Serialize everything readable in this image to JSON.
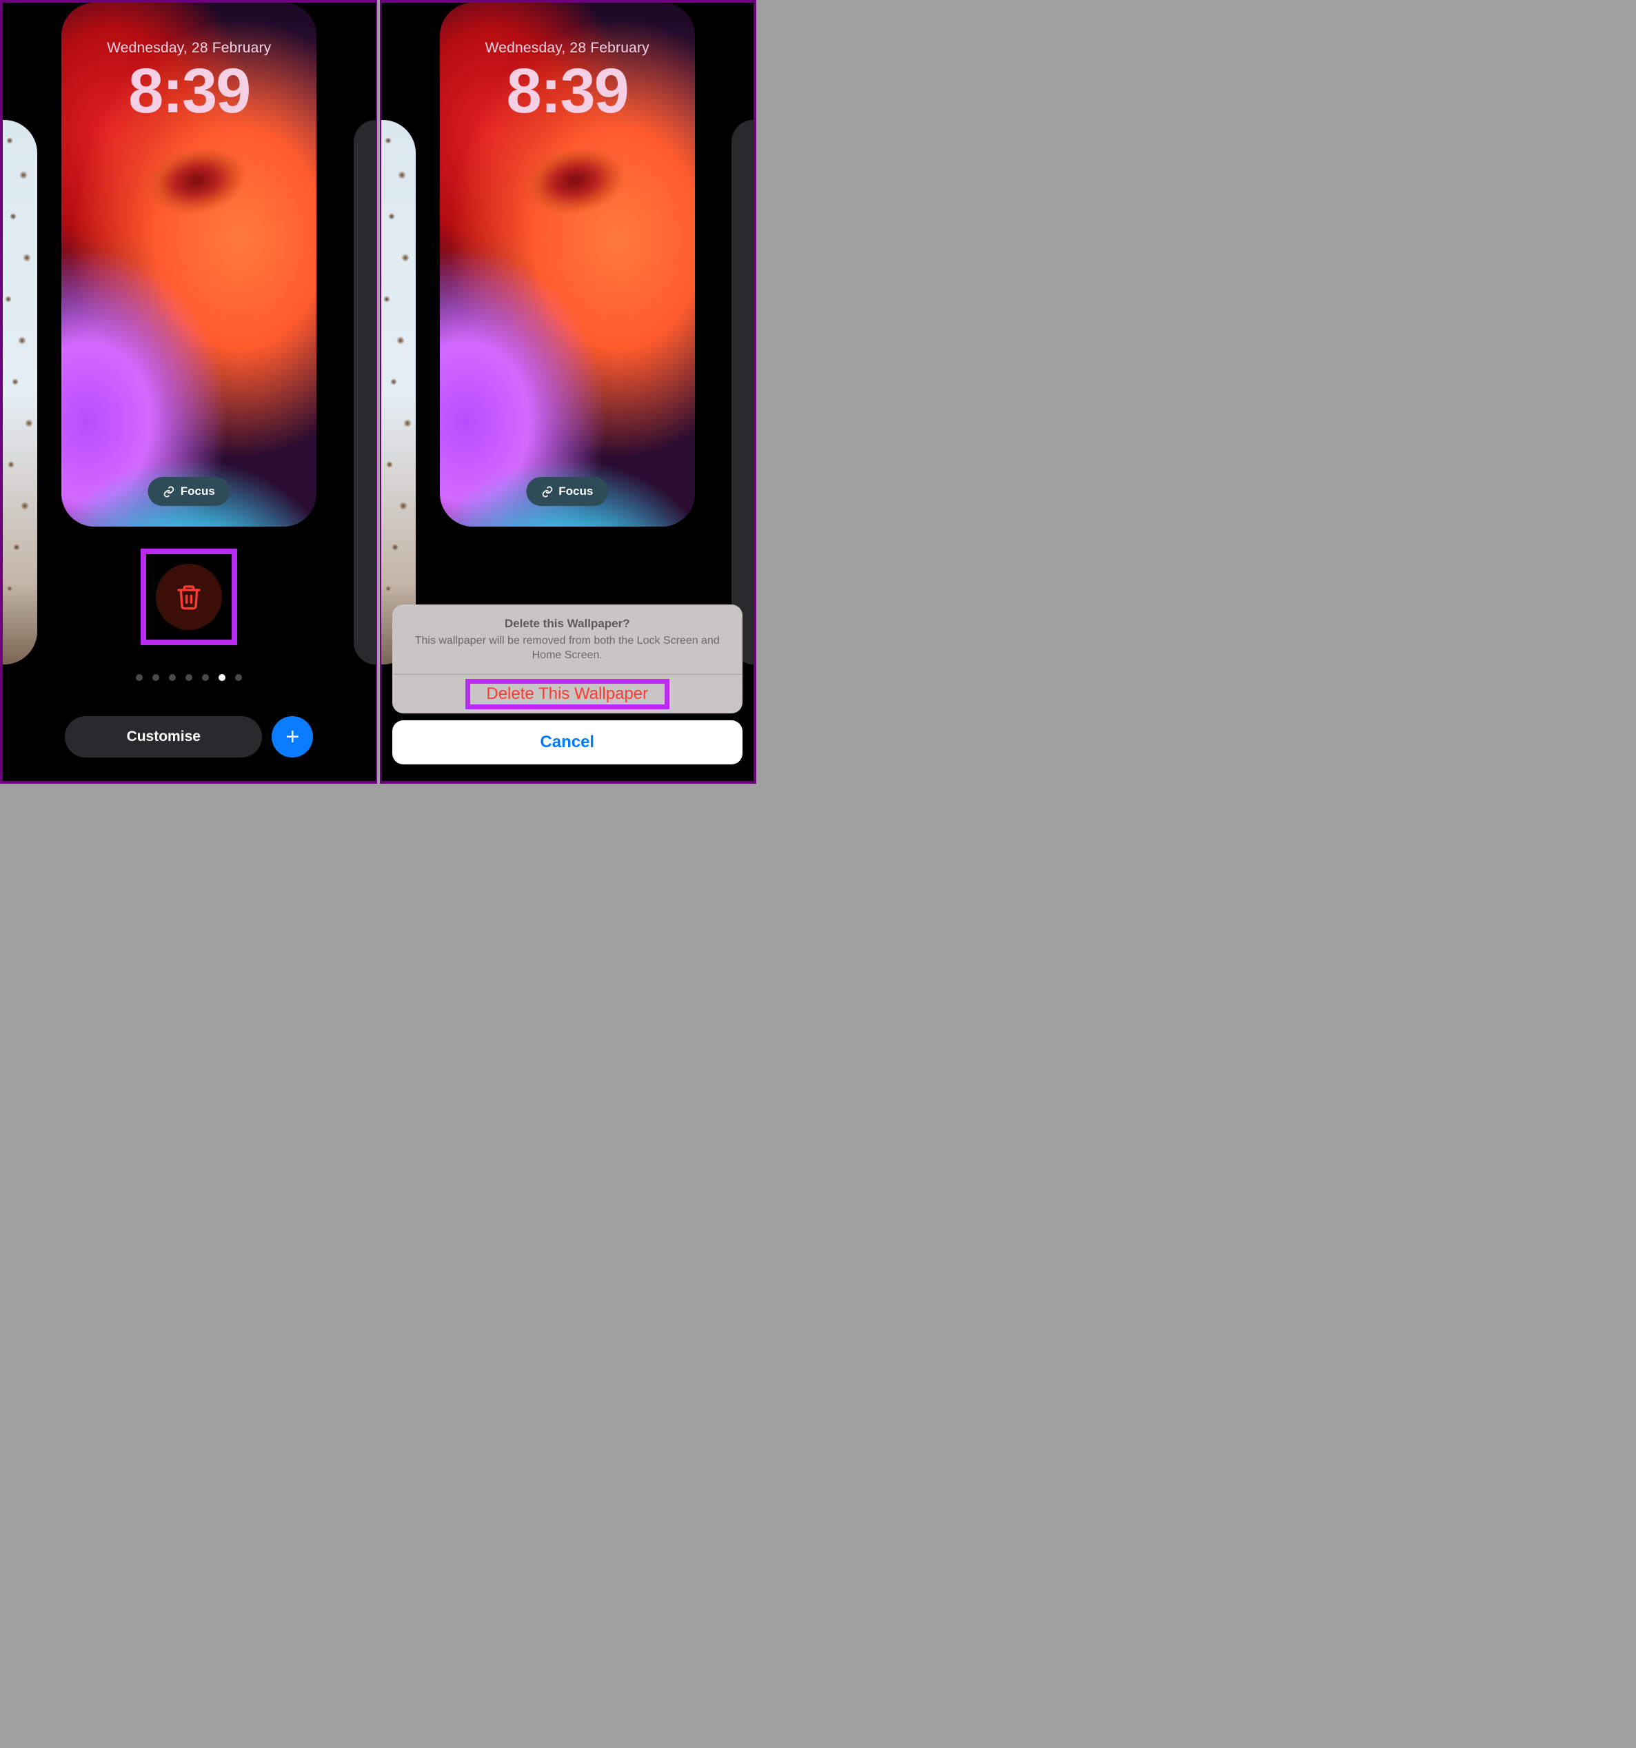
{
  "lockscreen": {
    "date": "Wednesday, 28 February",
    "time": "8:39",
    "focus_label": "Focus"
  },
  "controls": {
    "customise_label": "Customise",
    "page_dots_total": 7,
    "page_dot_active_index": 5
  },
  "action_sheet": {
    "title": "Delete this Wallpaper?",
    "message": "This wallpaper will be removed from both the Lock Screen and Home Screen.",
    "delete_label": "Delete This Wallpaper",
    "cancel_label": "Cancel"
  },
  "colors": {
    "highlight": "#b92df0",
    "destructive": "#ff3b30",
    "primary_blue": "#007aff",
    "add_blue": "#0a7cff"
  }
}
